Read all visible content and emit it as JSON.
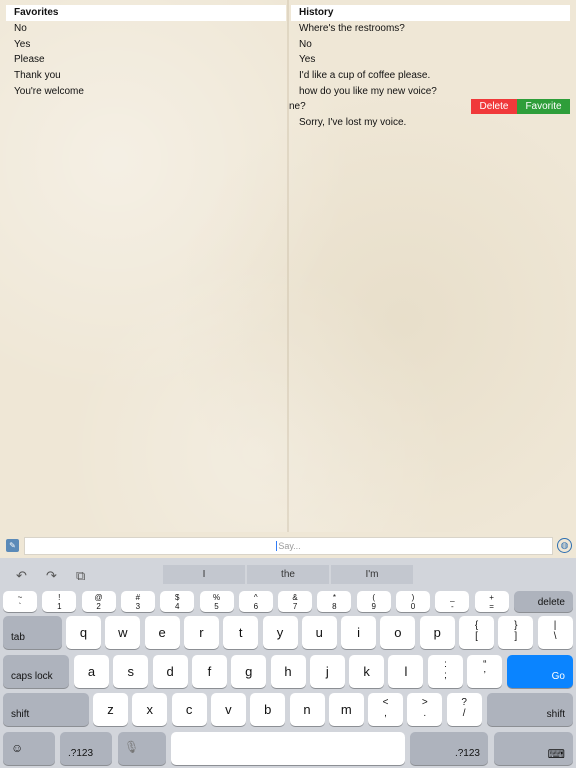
{
  "favorites": {
    "header": "Favorites",
    "items": [
      "No",
      "Yes",
      "Please",
      "Thank you",
      "You're welcome"
    ]
  },
  "history": {
    "header": "History",
    "items": [
      "Where's the restrooms?",
      "No",
      "Yes",
      "I'd like a cup of coffee please.",
      "how do you like my new voice?"
    ],
    "swiped_item": "ne?",
    "after_items": [
      "Sorry, I've lost my voice."
    ],
    "delete_label": "Delete",
    "favorite_label": "Favorite"
  },
  "say": {
    "placeholder": "Say..."
  },
  "suggestions": [
    "I",
    "the",
    "I'm"
  ],
  "keyboard": {
    "number_row": [
      {
        "top": "~",
        "bottom": "`"
      },
      {
        "top": "!",
        "bottom": "1"
      },
      {
        "top": "@",
        "bottom": "2"
      },
      {
        "top": "#",
        "bottom": "3"
      },
      {
        "top": "$",
        "bottom": "4"
      },
      {
        "top": "%",
        "bottom": "5"
      },
      {
        "top": "^",
        "bottom": "6"
      },
      {
        "top": "&",
        "bottom": "7"
      },
      {
        "top": "*",
        "bottom": "8"
      },
      {
        "top": "(",
        "bottom": "9"
      },
      {
        "top": ")",
        "bottom": "0"
      },
      {
        "top": "_",
        "bottom": "-"
      },
      {
        "top": "+",
        "bottom": "="
      }
    ],
    "delete_label": "delete",
    "tab_label": "tab",
    "row1": [
      "q",
      "w",
      "e",
      "r",
      "t",
      "y",
      "u",
      "i",
      "o",
      "p"
    ],
    "row1_extra": [
      {
        "top": "{",
        "bottom": "["
      },
      {
        "top": "}",
        "bottom": "]"
      },
      {
        "top": "|",
        "bottom": "\\"
      }
    ],
    "caps_label": "caps lock",
    "row2": [
      "a",
      "s",
      "d",
      "f",
      "g",
      "h",
      "j",
      "k",
      "l"
    ],
    "row2_extra": [
      {
        "top": ":",
        "bottom": ";"
      },
      {
        "top": "“",
        "bottom": "’"
      }
    ],
    "go_label": "Go",
    "shift_label": "shift",
    "row3": [
      "z",
      "x",
      "c",
      "v",
      "b",
      "n",
      "m"
    ],
    "row3_extra": [
      {
        "top": "<",
        "bottom": ","
      },
      {
        "top": ">",
        "bottom": "."
      },
      {
        "top": "?",
        "bottom": "/"
      }
    ],
    "numbers_label": ".?123",
    "colors": {
      "go_key": "#0a84ff",
      "delete_swipe": "#f0393a",
      "favorite_swipe": "#2e9e3a"
    }
  }
}
